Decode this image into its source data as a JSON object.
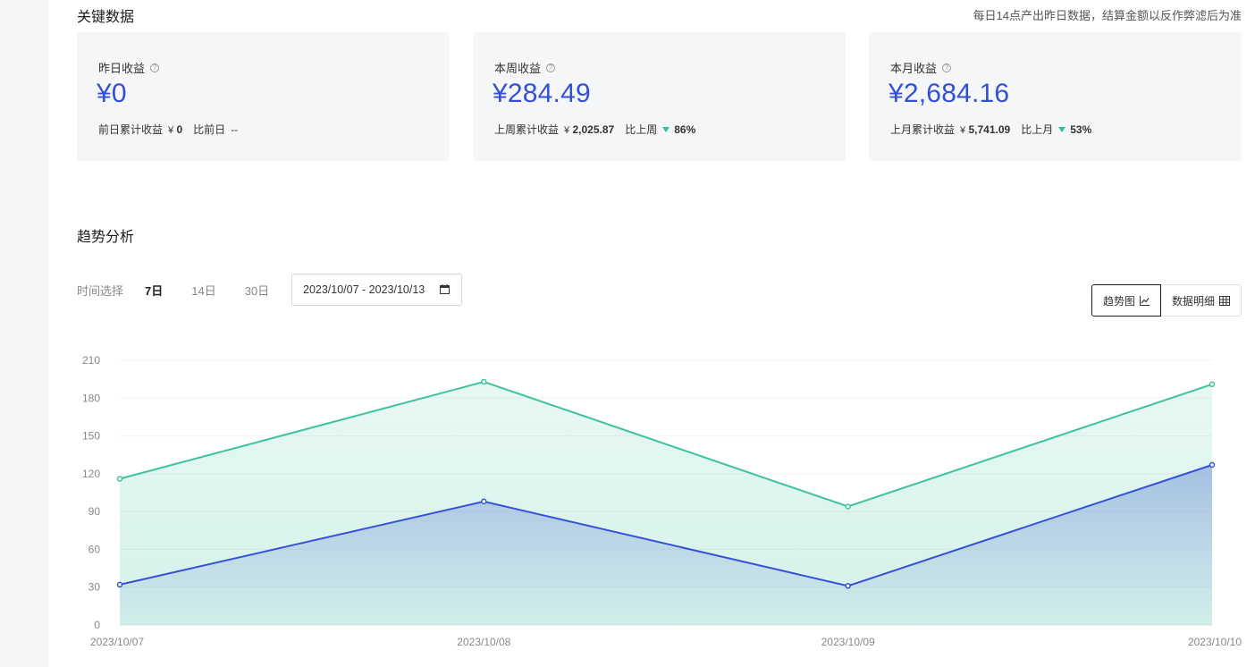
{
  "header": {
    "title": "关键数据",
    "note": "每日14点产出昨日数据，结算金额以反作弊滤后为准"
  },
  "cards": [
    {
      "label": "昨日收益",
      "currency": "¥",
      "value": "0",
      "prev_label": "前日累计收益",
      "prev_value": "0",
      "compare_label": "比前日",
      "compare_value": "--",
      "trend": "none"
    },
    {
      "label": "本周收益",
      "currency": "¥",
      "value": "284.49",
      "prev_label": "上周累计收益",
      "prev_value": "2,025.87",
      "compare_label": "比上周",
      "compare_value": "86%",
      "trend": "down"
    },
    {
      "label": "本月收益",
      "currency": "¥",
      "value": "2,684.16",
      "prev_label": "上月累计收益",
      "prev_value": "5,741.09",
      "compare_label": "比上月",
      "compare_value": "53%",
      "trend": "down"
    }
  ],
  "trend": {
    "title": "趋势分析",
    "time_label": "时间选择",
    "ranges": [
      "7日",
      "14日",
      "30日"
    ],
    "active_range": "7日",
    "date_range": "2023/10/07 - 2023/10/13",
    "view_chart_label": "趋势图",
    "view_table_label": "数据明细"
  },
  "icons": {
    "help": "help-circle-icon",
    "down": "triangle-down-icon",
    "calendar": "calendar-icon",
    "line_chart": "line-chart-icon",
    "table": "table-icon"
  },
  "colors": {
    "accent": "#3350d4",
    "green_series": "#3ec39f",
    "blue_series": "#3651d8",
    "card_bg": "#f5f6f8"
  },
  "chart_data": {
    "type": "area",
    "x": [
      "2023/10/07",
      "2023/10/08",
      "2023/10/09",
      "2023/10/10"
    ],
    "ylim": [
      0,
      210
    ],
    "yticks": [
      0,
      30,
      60,
      90,
      120,
      150,
      180,
      210
    ],
    "grid": true,
    "series": [
      {
        "values": [
          116,
          193,
          94,
          191
        ],
        "color": "#3ec39f"
      },
      {
        "values": [
          32,
          98,
          31,
          127
        ],
        "color": "#3651d8"
      }
    ]
  }
}
